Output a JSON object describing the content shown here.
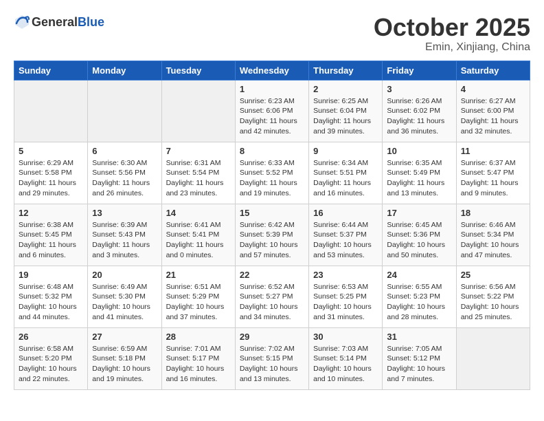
{
  "header": {
    "logo_general": "General",
    "logo_blue": "Blue",
    "month": "October 2025",
    "location": "Emin, Xinjiang, China"
  },
  "weekdays": [
    "Sunday",
    "Monday",
    "Tuesday",
    "Wednesday",
    "Thursday",
    "Friday",
    "Saturday"
  ],
  "weeks": [
    [
      {
        "day": "",
        "info": ""
      },
      {
        "day": "",
        "info": ""
      },
      {
        "day": "",
        "info": ""
      },
      {
        "day": "1",
        "info": "Sunrise: 6:23 AM\nSunset: 6:06 PM\nDaylight: 11 hours and 42 minutes."
      },
      {
        "day": "2",
        "info": "Sunrise: 6:25 AM\nSunset: 6:04 PM\nDaylight: 11 hours and 39 minutes."
      },
      {
        "day": "3",
        "info": "Sunrise: 6:26 AM\nSunset: 6:02 PM\nDaylight: 11 hours and 36 minutes."
      },
      {
        "day": "4",
        "info": "Sunrise: 6:27 AM\nSunset: 6:00 PM\nDaylight: 11 hours and 32 minutes."
      }
    ],
    [
      {
        "day": "5",
        "info": "Sunrise: 6:29 AM\nSunset: 5:58 PM\nDaylight: 11 hours and 29 minutes."
      },
      {
        "day": "6",
        "info": "Sunrise: 6:30 AM\nSunset: 5:56 PM\nDaylight: 11 hours and 26 minutes."
      },
      {
        "day": "7",
        "info": "Sunrise: 6:31 AM\nSunset: 5:54 PM\nDaylight: 11 hours and 23 minutes."
      },
      {
        "day": "8",
        "info": "Sunrise: 6:33 AM\nSunset: 5:52 PM\nDaylight: 11 hours and 19 minutes."
      },
      {
        "day": "9",
        "info": "Sunrise: 6:34 AM\nSunset: 5:51 PM\nDaylight: 11 hours and 16 minutes."
      },
      {
        "day": "10",
        "info": "Sunrise: 6:35 AM\nSunset: 5:49 PM\nDaylight: 11 hours and 13 minutes."
      },
      {
        "day": "11",
        "info": "Sunrise: 6:37 AM\nSunset: 5:47 PM\nDaylight: 11 hours and 9 minutes."
      }
    ],
    [
      {
        "day": "12",
        "info": "Sunrise: 6:38 AM\nSunset: 5:45 PM\nDaylight: 11 hours and 6 minutes."
      },
      {
        "day": "13",
        "info": "Sunrise: 6:39 AM\nSunset: 5:43 PM\nDaylight: 11 hours and 3 minutes."
      },
      {
        "day": "14",
        "info": "Sunrise: 6:41 AM\nSunset: 5:41 PM\nDaylight: 11 hours and 0 minutes."
      },
      {
        "day": "15",
        "info": "Sunrise: 6:42 AM\nSunset: 5:39 PM\nDaylight: 10 hours and 57 minutes."
      },
      {
        "day": "16",
        "info": "Sunrise: 6:44 AM\nSunset: 5:37 PM\nDaylight: 10 hours and 53 minutes."
      },
      {
        "day": "17",
        "info": "Sunrise: 6:45 AM\nSunset: 5:36 PM\nDaylight: 10 hours and 50 minutes."
      },
      {
        "day": "18",
        "info": "Sunrise: 6:46 AM\nSunset: 5:34 PM\nDaylight: 10 hours and 47 minutes."
      }
    ],
    [
      {
        "day": "19",
        "info": "Sunrise: 6:48 AM\nSunset: 5:32 PM\nDaylight: 10 hours and 44 minutes."
      },
      {
        "day": "20",
        "info": "Sunrise: 6:49 AM\nSunset: 5:30 PM\nDaylight: 10 hours and 41 minutes."
      },
      {
        "day": "21",
        "info": "Sunrise: 6:51 AM\nSunset: 5:29 PM\nDaylight: 10 hours and 37 minutes."
      },
      {
        "day": "22",
        "info": "Sunrise: 6:52 AM\nSunset: 5:27 PM\nDaylight: 10 hours and 34 minutes."
      },
      {
        "day": "23",
        "info": "Sunrise: 6:53 AM\nSunset: 5:25 PM\nDaylight: 10 hours and 31 minutes."
      },
      {
        "day": "24",
        "info": "Sunrise: 6:55 AM\nSunset: 5:23 PM\nDaylight: 10 hours and 28 minutes."
      },
      {
        "day": "25",
        "info": "Sunrise: 6:56 AM\nSunset: 5:22 PM\nDaylight: 10 hours and 25 minutes."
      }
    ],
    [
      {
        "day": "26",
        "info": "Sunrise: 6:58 AM\nSunset: 5:20 PM\nDaylight: 10 hours and 22 minutes."
      },
      {
        "day": "27",
        "info": "Sunrise: 6:59 AM\nSunset: 5:18 PM\nDaylight: 10 hours and 19 minutes."
      },
      {
        "day": "28",
        "info": "Sunrise: 7:01 AM\nSunset: 5:17 PM\nDaylight: 10 hours and 16 minutes."
      },
      {
        "day": "29",
        "info": "Sunrise: 7:02 AM\nSunset: 5:15 PM\nDaylight: 10 hours and 13 minutes."
      },
      {
        "day": "30",
        "info": "Sunrise: 7:03 AM\nSunset: 5:14 PM\nDaylight: 10 hours and 10 minutes."
      },
      {
        "day": "31",
        "info": "Sunrise: 7:05 AM\nSunset: 5:12 PM\nDaylight: 10 hours and 7 minutes."
      },
      {
        "day": "",
        "info": ""
      }
    ]
  ]
}
